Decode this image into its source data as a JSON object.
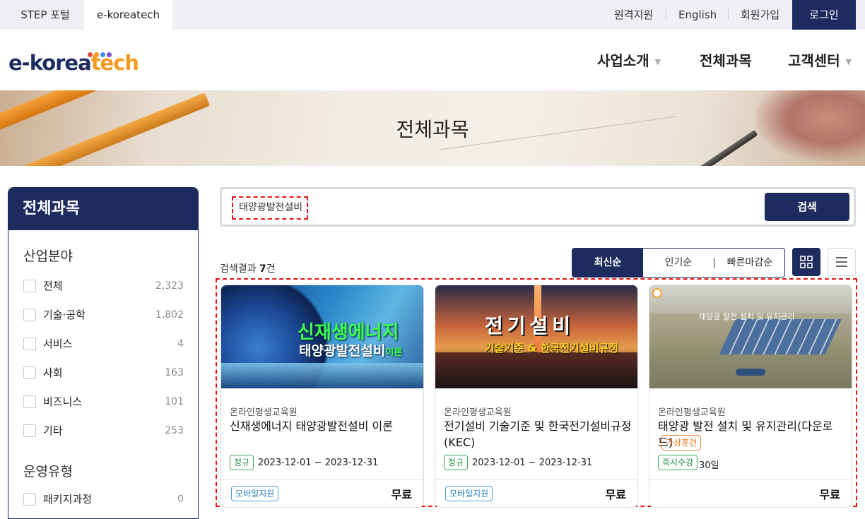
{
  "topbar": {
    "tabs": [
      {
        "label": "STEP 포털"
      },
      {
        "label": "e-koreatech"
      }
    ],
    "utils": [
      {
        "label": "원격지원"
      },
      {
        "label": "English"
      },
      {
        "label": "회원가입"
      }
    ],
    "login": "로그인"
  },
  "header": {
    "logo_a": "e-korea",
    "logo_b": "tech",
    "logo_dots": [
      "#e3493e",
      "#f39a1e",
      "#3e8de3",
      "#7b4fc8"
    ],
    "nav": [
      {
        "label": "사업소개",
        "has_dropdown": true
      },
      {
        "label": "전체과목",
        "has_dropdown": false
      },
      {
        "label": "고객센터",
        "has_dropdown": true
      }
    ]
  },
  "banner": {
    "title": "전체과목"
  },
  "sidebar": {
    "title": "전체과목",
    "group1": "산업분야",
    "items": [
      {
        "label": "전체",
        "count": "2,323"
      },
      {
        "label": "기술·공학",
        "count": "1,802"
      },
      {
        "label": "서비스",
        "count": "4"
      },
      {
        "label": "사회",
        "count": "163"
      },
      {
        "label": "비즈니스",
        "count": "101"
      },
      {
        "label": "기타",
        "count": "253"
      }
    ],
    "group2": "운영유형",
    "items2": [
      {
        "label": "패키지과정",
        "count": "0"
      }
    ]
  },
  "search": {
    "value": "태양광발전설비",
    "button": "검색"
  },
  "results": {
    "label": "검색결과",
    "count": "7",
    "unit": "건"
  },
  "sort": {
    "options": [
      "최신순",
      "인기순",
      "빠른마감순"
    ],
    "selected": "최신순"
  },
  "view_toggle": {
    "grid_icon": "grid-icon",
    "list_icon": "list-icon",
    "active": "grid"
  },
  "cards": [
    {
      "thumb_title": "신재생에너지",
      "thumb_sub": "태양광발전설비",
      "thumb_sub2": "이론",
      "org": "온라인평생교육원",
      "title": "신재생에너지 태양광발전설비 이론",
      "badge": "정규",
      "date": "2023-12-01 ~ 2023-12-31",
      "mobile": "모바일지원",
      "price": "무료"
    },
    {
      "thumb_title": "전기설비",
      "thumb_sub": "기술기준 & 한국전기설비규정",
      "org": "온라인평생교육원",
      "title": "전기설비 기술기준 및 한국전기설비규정(KEC)",
      "badge": "정규",
      "date": "2023-12-01 ~ 2023-12-31",
      "mobile": "모바일지원",
      "price": "무료"
    },
    {
      "thumb_title": "태양광 발전 설치 및 유지관리",
      "org": "온라인평생교육원",
      "title": "태양광 발전 설치 및 유지관리(다운로드)",
      "tag": "가상훈련",
      "badge": "즉시수강",
      "date": "30일",
      "price": "무료"
    }
  ]
}
